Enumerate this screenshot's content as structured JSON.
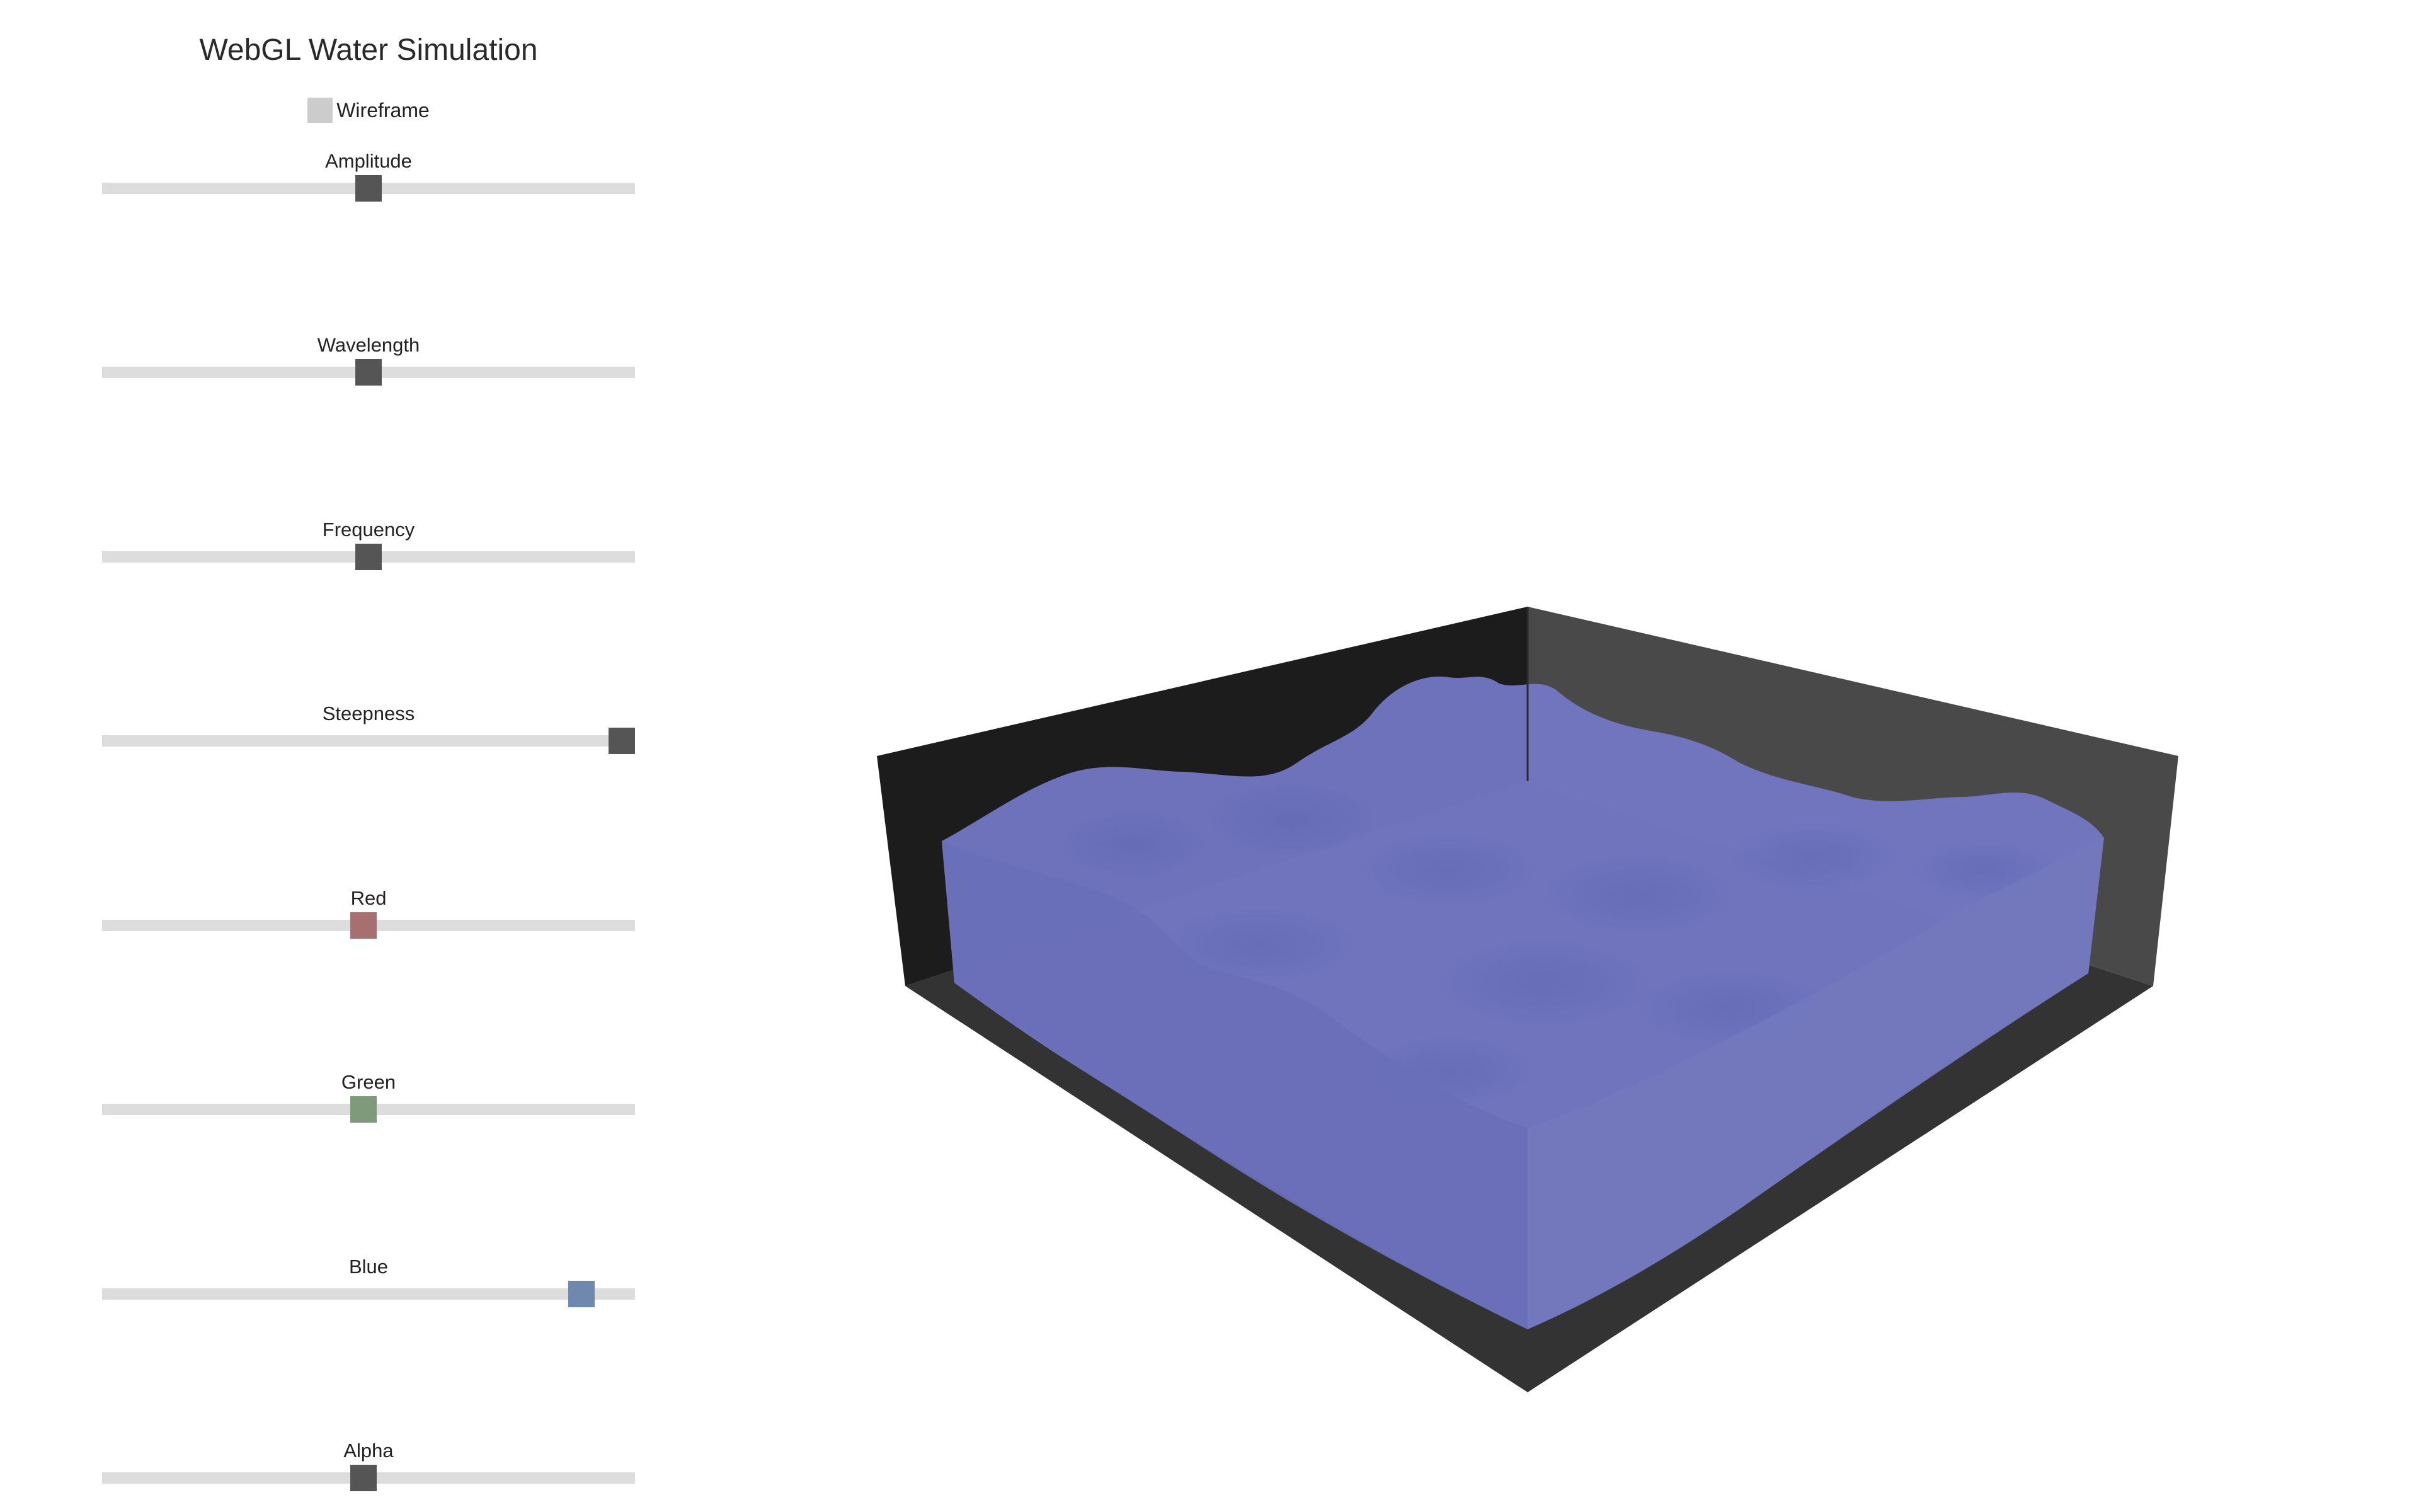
{
  "title": "WebGL Water Simulation",
  "wireframe": {
    "label": "Wireframe",
    "checked": false
  },
  "sliders": [
    {
      "id": "amplitude",
      "label": "Amplitude",
      "value": 0.5,
      "thumb_color": "#555555"
    },
    {
      "id": "wavelength",
      "label": "Wavelength",
      "value": 0.5,
      "thumb_color": "#555555"
    },
    {
      "id": "frequency",
      "label": "Frequency",
      "value": 0.5,
      "thumb_color": "#555555"
    },
    {
      "id": "steepness",
      "label": "Steepness",
      "value": 1.0,
      "thumb_color": "#555555"
    },
    {
      "id": "red",
      "label": "Red",
      "value": 0.49,
      "thumb_color": "#a67070"
    },
    {
      "id": "green",
      "label": "Green",
      "value": 0.49,
      "thumb_color": "#7f9a7b"
    },
    {
      "id": "blue",
      "label": "Blue",
      "value": 0.9,
      "thumb_color": "#6f88ad"
    },
    {
      "id": "alpha",
      "label": "Alpha",
      "value": 0.49,
      "thumb_color": "#555555"
    }
  ],
  "colors": {
    "track": "#dddddd",
    "water": "#7479c9",
    "tank_back_left": "#1c1c1c",
    "tank_back_right": "#494949",
    "tank_floor": "#333333"
  }
}
